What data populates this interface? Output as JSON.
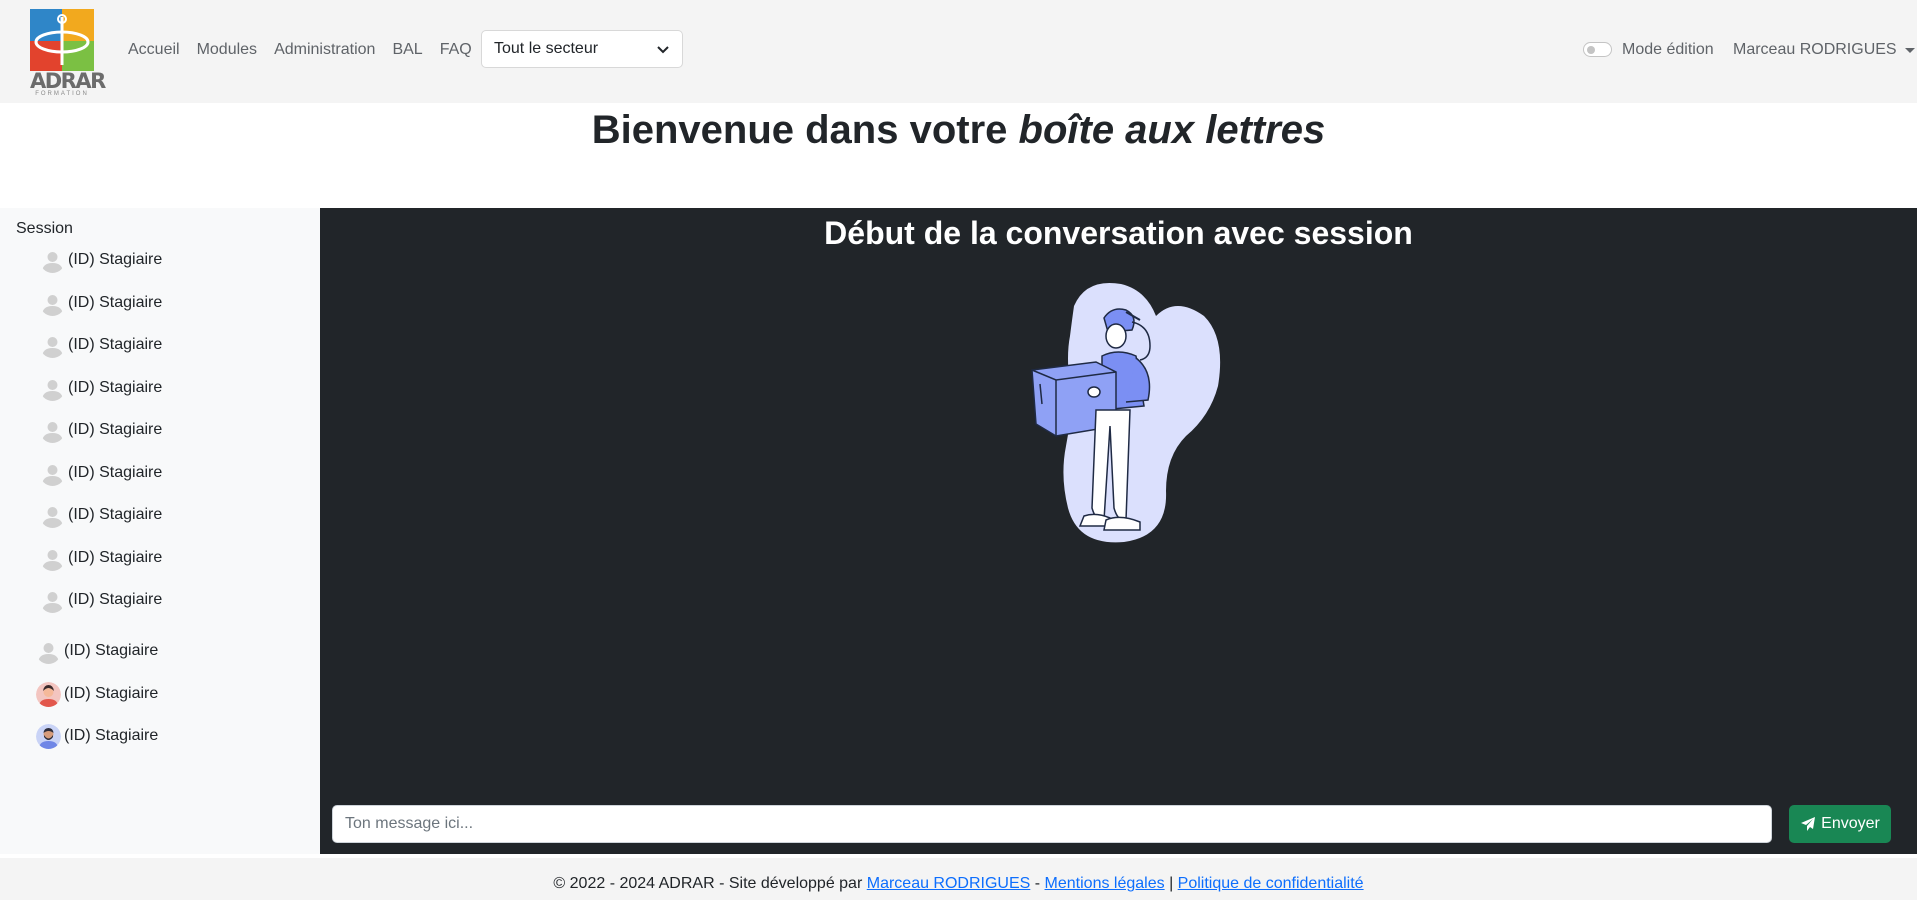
{
  "navbar": {
    "logo": {
      "text": "ADRAR",
      "subtext": "FORMATION"
    },
    "links": [
      "Accueil",
      "Modules",
      "Administration",
      "BAL",
      "FAQ"
    ],
    "sector_select": {
      "value": "Tout le secteur"
    },
    "edit_mode": {
      "label": "Mode édition",
      "enabled": false
    },
    "user_name": "Marceau RODRIGUES"
  },
  "page_title": {
    "prefix": "Bienvenue dans votre ",
    "emphasis": "boîte aux lettres"
  },
  "sidebar": {
    "group_label": "Session",
    "contacts": [
      {
        "label": "(ID) Stagiaire",
        "avatar": "default-avatar-icon"
      },
      {
        "label": "(ID) Stagiaire",
        "avatar": "default-avatar-icon"
      },
      {
        "label": "(ID) Stagiaire",
        "avatar": "default-avatar-icon"
      },
      {
        "label": "(ID) Stagiaire",
        "avatar": "default-avatar-icon"
      },
      {
        "label": "(ID) Stagiaire",
        "avatar": "default-avatar-icon"
      },
      {
        "label": "(ID) Stagiaire",
        "avatar": "default-avatar-icon"
      },
      {
        "label": "(ID) Stagiaire",
        "avatar": "default-avatar-icon"
      },
      {
        "label": "(ID) Stagiaire",
        "avatar": "default-avatar-icon"
      },
      {
        "label": "(ID) Stagiaire",
        "avatar": "default-avatar-icon"
      },
      {
        "label": "(ID) Stagiaire",
        "avatar": "default-avatar-icon"
      },
      {
        "label": "(ID) Stagiaire",
        "avatar": "woman-avatar-icon"
      },
      {
        "label": "(ID) Stagiaire",
        "avatar": "bearded-man-avatar-icon"
      }
    ]
  },
  "chat": {
    "title": "Début de la conversation avec session",
    "illustration": "delivery-person-with-box",
    "input_placeholder": "Ton message ici...",
    "send_label": "Envoyer",
    "send_icon": "paper-plane-icon"
  },
  "footer": {
    "prefix": "© 2022 - 2024 ADRAR - Site développé par ",
    "author": "Marceau RODRIGUES",
    "separator1": " - ",
    "legal": "Mentions légales",
    "separator2": " | ",
    "privacy": "Politique de confidentialité"
  },
  "colors": {
    "navbar_bg": "#f4f4f4",
    "chat_bg": "#212529",
    "sidebar_bg": "#f8f9fa",
    "send_button": "#198754",
    "link": "#0d6efd",
    "illustration_blob": "#dbe0fd",
    "illustration_accent": "#7b8ff3"
  }
}
